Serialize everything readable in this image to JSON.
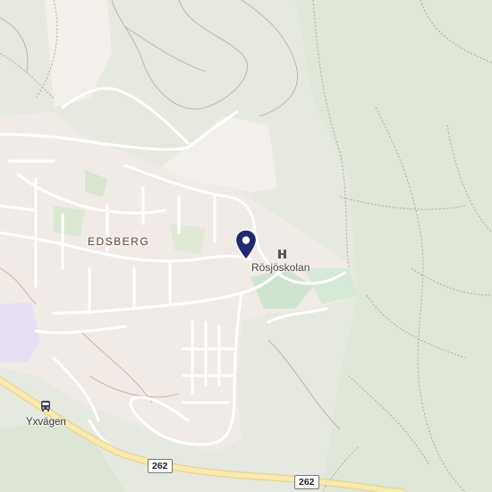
{
  "map": {
    "labels": {
      "district": "EDSBERG",
      "school": "Rösjöskolan",
      "bus_stop": "Yxvägen"
    },
    "routes": [
      {
        "number": "262"
      },
      {
        "number": "262"
      }
    ],
    "icons": {
      "pin": "location-pin-icon",
      "school": "school-icon",
      "bus": "bus-icon"
    },
    "colors": {
      "background": "#e6e9df",
      "forest": "#dfe6d8",
      "built_area": "#f2ecea",
      "road": "#ffffff",
      "highway": "#f7e7a1",
      "pin": "#1f2b6e",
      "trail": "#b59b8a"
    }
  }
}
